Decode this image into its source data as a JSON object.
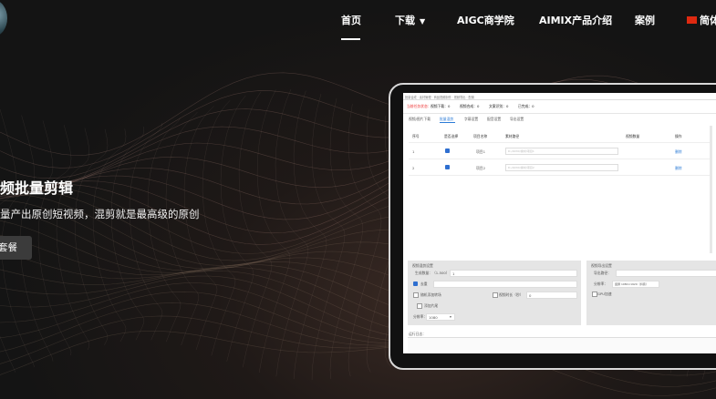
{
  "nav": {
    "items": [
      "首页",
      "下载",
      "AIGC商学院",
      "AIMIX产品介绍",
      "案例"
    ],
    "language": "简体",
    "active_index": 0
  },
  "hero": {
    "title": "频批量剪辑",
    "subtitle": "量产出原创短视频，混剪就是最高级的原创",
    "button": "套餐"
  },
  "app": {
    "menubar": "批量合成 · 素材管理 · 商品视频制作 · 视频导出 · 配置",
    "status": {
      "label_red": "当前任务状态：",
      "items": [
        "视频下载：0",
        "视频合成：0",
        "文案识别：0",
        "已完成：0"
      ]
    },
    "tabs": [
      "视频/图片下载",
      "批量混剪",
      "字幕设置",
      "配音设置",
      "导出设置"
    ],
    "table": {
      "headers": [
        "序号",
        "是否选择",
        "项目名称",
        "素材路径",
        "视频数量",
        "操作"
      ],
      "rows": [
        {
          "index": "1",
          "name": "项目1",
          "path": "D:/AIMIX/素材/项目1",
          "count": "",
          "action": "删除"
        },
        {
          "index": "2",
          "name": "项目2",
          "path": "D:/AIMIX/素材/项目2",
          "count": "",
          "action": "删除"
        }
      ]
    },
    "left_panel": {
      "title": "视频混剪设置",
      "count_label": "生成数量：（1-500）",
      "count_value": "1",
      "option1": "去重",
      "option2": "随机添加转场",
      "option3": "视频时长（秒）",
      "option3_value": "0",
      "option4": "添加片尾",
      "resolution_label": "分辨率：",
      "resolution_value": "1080"
    },
    "right_panel": {
      "title": "视频导出设置",
      "path_label": "导出路径：",
      "format_label": "分辨率：",
      "format_value": "竖屏 1080×1920（抖音）",
      "gpu_label": "GPU加速"
    },
    "footer_label": "运行日志："
  }
}
